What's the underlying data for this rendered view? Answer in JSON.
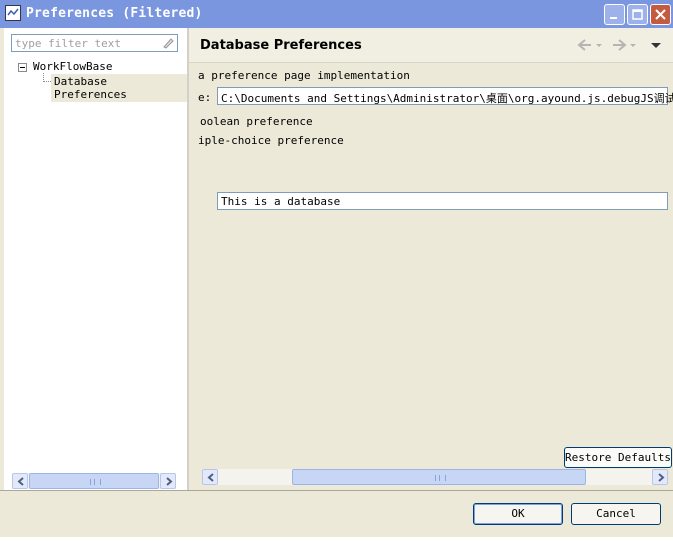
{
  "window": {
    "title": "Preferences (Filtered)"
  },
  "filter": {
    "placeholder": "type filter text"
  },
  "tree": {
    "root": "WorkFlowBase",
    "child": "Database Preferences"
  },
  "page": {
    "title": "Database Preferences",
    "description": "a preference page implementation",
    "path_label": "e:",
    "path_value": "C:\\Documents and Settings\\Administrator\\桌面\\org.ayound.js.debugJS调试源码",
    "boolean_label": "oolean preference",
    "choice_label": "iple-choice preference",
    "text_value": "This is a database"
  },
  "buttons": {
    "restore": "Restore Defaults",
    "ok": "OK",
    "cancel": "Cancel"
  },
  "colors": {
    "titlebar": "#7a96df",
    "window": "#ece9d8",
    "close": "#c45a3f"
  }
}
